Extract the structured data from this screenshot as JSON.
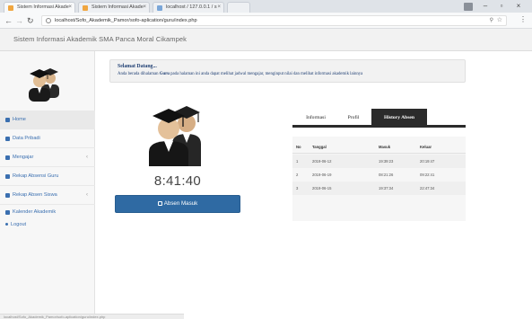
{
  "browser": {
    "tabs": [
      {
        "label": "Sistem Informasi Akade"
      },
      {
        "label": "Sistem Informasi Akade"
      },
      {
        "label": "localhost / 127.0.0.1 / s"
      }
    ],
    "url": "localhost/Sofo_Akademik_Pamor/sofo-aplication/guru/index.php"
  },
  "app": {
    "title": "Sistem Informasi Akademik SMA Panca Moral Cikampek"
  },
  "sidebar": {
    "items": [
      {
        "label": "Home",
        "icon": "home-icon"
      },
      {
        "label": "Data Pribadi",
        "icon": "user-icon"
      },
      {
        "label": "Mengajar",
        "icon": "book-icon",
        "chevron": "‹"
      },
      {
        "label": "Rekap Absensi Guru",
        "icon": "list-icon"
      },
      {
        "label": "Rekap Absen Siswa",
        "icon": "list-icon",
        "chevron": "‹"
      },
      {
        "label": "Kalender Akademik",
        "icon": "calendar-icon"
      }
    ],
    "logout": "Logout"
  },
  "alert": {
    "title": "Selamat Datang...",
    "text_before": "Anda berada dihalaman ",
    "text_bold": "Guru",
    "text_after": " pada halaman ini anda dapat melihat jadwal mengajar, menginput nilai dan melihat informasi akademik lainnya"
  },
  "attendance": {
    "clock": "8:41:40",
    "button_label": "Absen Masuk"
  },
  "panel": {
    "tabs": [
      {
        "label": "Informasi",
        "active": false
      },
      {
        "label": "Profil",
        "active": false
      },
      {
        "label": "History Absen",
        "active": true
      }
    ],
    "table": {
      "headers": [
        "No",
        "Tanggal",
        "Masuk",
        "Keluar"
      ],
      "rows": [
        [
          "1",
          "2019-06-12",
          "19:39:23",
          "20:19:47"
        ],
        [
          "2",
          "2019-06-19",
          "08:21:26",
          "09:22:41"
        ],
        [
          "3",
          "2019-06-15",
          "19:37:34",
          "22:47:34"
        ]
      ]
    }
  },
  "statusbar": {
    "text": "localhost/Sofo_Akademik_Pamor/sofo-aplication/guru/index.php"
  },
  "colors": {
    "primary_button": "#2f6aa3",
    "sidebar_link": "#3a6fb0",
    "tab_active": "#2b2b2b"
  }
}
